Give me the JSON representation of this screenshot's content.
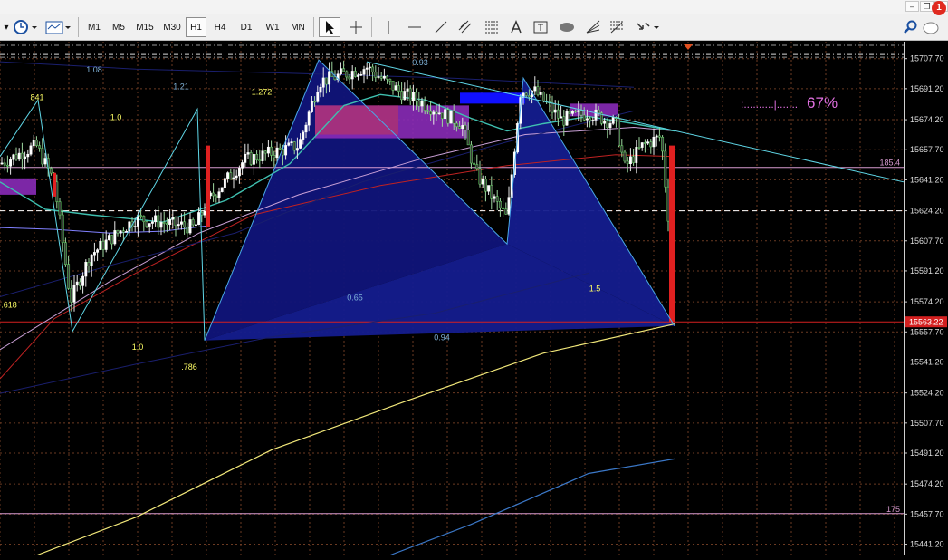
{
  "toolbar": {
    "timeframes": [
      "M1",
      "M5",
      "M15",
      "M30",
      "H1",
      "H4",
      "D1",
      "W1",
      "MN"
    ],
    "active_timeframe": "H1",
    "notification_count": "1"
  },
  "chart_data": {
    "type": "candlestick",
    "ylim": [
      15435,
      15717
    ],
    "price_ticks": [
      15707.7,
      15691.2,
      15674.2,
      15657.7,
      15641.2,
      15624.2,
      15607.7,
      15591.2,
      15574.2,
      15557.7,
      15541.2,
      15524.2,
      15507.7,
      15491.2,
      15474.2,
      15457.7,
      15441.2
    ],
    "current_price": "15563.22",
    "ask_price": 15624.2,
    "level_lines": [
      {
        "label": "185.4",
        "value": 15648,
        "color": "#d89bd0"
      },
      {
        "label": "175",
        "value": 15458,
        "color": "#d89bd0"
      }
    ],
    "indicator_text": ":..........|.......",
    "indicator_percent": "67%",
    "fib_labels": [
      {
        "text": "841",
        "color": "#ffff66",
        "x": 41,
        "value": 15685
      },
      {
        "text": "1.0",
        "color": "#ffff66",
        "x": 128,
        "value": 15674
      },
      {
        "text": "1.08",
        "color": "#7fb2d8",
        "x": 104,
        "value": 15700
      },
      {
        "text": "1.21",
        "color": "#7fb2d8",
        "x": 200,
        "value": 15691
      },
      {
        "text": "1.272",
        "color": "#ffff66",
        "x": 289,
        "value": 15688
      },
      {
        "text": "0.93",
        "color": "#7fb2d8",
        "x": 464,
        "value": 15704
      },
      {
        "text": ".618",
        "color": "#ffff66",
        "x": 10,
        "value": 15571
      },
      {
        "text": "1.0",
        "color": "#ffff66",
        "x": 152,
        "value": 15548
      },
      {
        "text": ".786",
        "color": "#ffff66",
        "x": 209,
        "value": 15537
      },
      {
        "text": "0.65",
        "color": "#7fb2d8",
        "x": 392,
        "value": 15575
      },
      {
        "text": "0.94",
        "color": "#7fb2d8",
        "x": 488,
        "value": 15553
      },
      {
        "text": "1.5",
        "color": "#ffff66",
        "x": 657,
        "value": 15580
      }
    ]
  }
}
